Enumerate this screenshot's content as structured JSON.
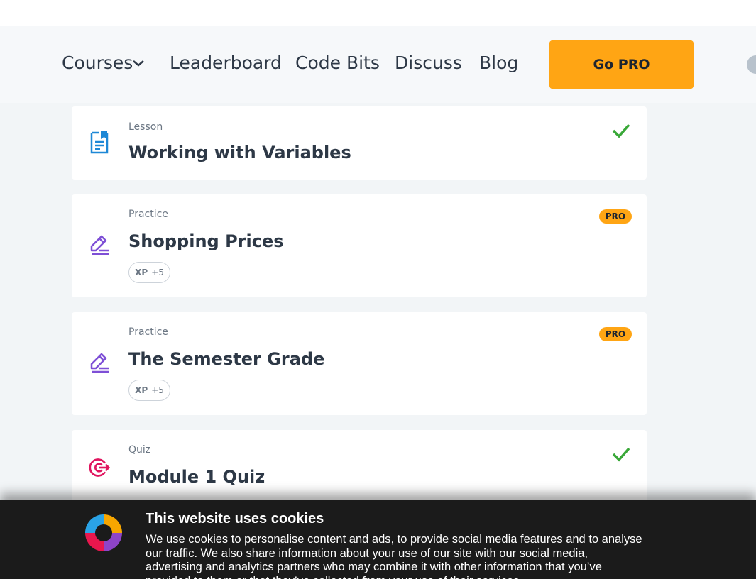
{
  "nav": {
    "courses": "Courses",
    "leaderboard": "Leaderboard",
    "code_bits": "Code Bits",
    "discuss": "Discuss",
    "blog": "Blog",
    "go_pro": "Go PRO"
  },
  "lessons": [
    {
      "type": "Lesson",
      "title": "Working with Variables",
      "status": "completed",
      "icon": "lesson-icon"
    },
    {
      "type": "Practice",
      "title": "Shopping Prices",
      "badge": "PRO",
      "xp_label": "XP",
      "xp_value": "+5",
      "icon": "practice-icon"
    },
    {
      "type": "Practice",
      "title": "The Semester Grade",
      "badge": "PRO",
      "xp_label": "XP",
      "xp_value": "+5",
      "icon": "practice-icon"
    },
    {
      "type": "Quiz",
      "title": "Module 1 Quiz",
      "status": "completed",
      "icon": "quiz-icon"
    }
  ],
  "cookie_banner": {
    "title": "This website uses cookies",
    "text": "We use cookies to personalise content and ads, to provide social media features and to analyse our traffic. We also share information about your use of our site with our social media, advertising and analytics partners who may combine it with other information that you’ve provided to them or that they’ve collected from your use of their services."
  },
  "colors": {
    "accent": "#ffa514",
    "check": "#39a838",
    "lesson_icon": "#1e88d6",
    "practice_icon": "#7e4fd6",
    "quiz_icon": "#e0155f"
  }
}
